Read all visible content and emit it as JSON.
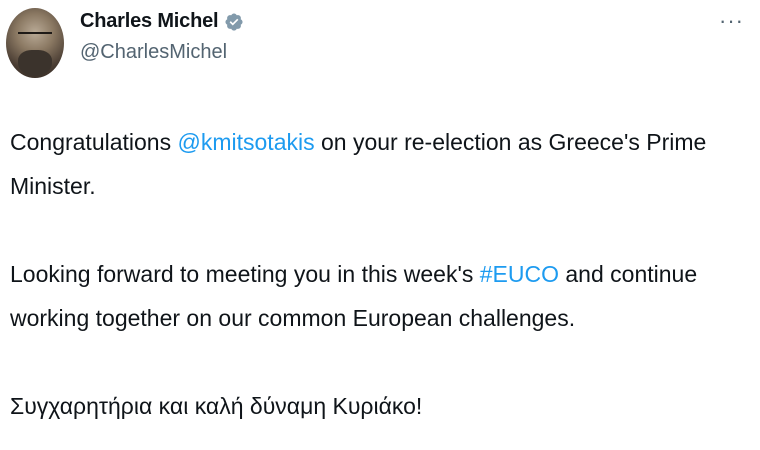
{
  "author": {
    "display_name": "Charles Michel",
    "handle": "@CharlesMichel",
    "verified_icon": "verified-badge-icon"
  },
  "menu": {
    "more_label": "···"
  },
  "tweet": {
    "p1": {
      "before": "Congratulations ",
      "mention": "@kmitsotakis",
      "after": " on your re-election as Greece's Prime Minister."
    },
    "p2": {
      "before": "Looking forward to meeting you in this week's ",
      "hashtag": "#EUCO",
      "after": " and continue working together on our common European challenges."
    },
    "p3": "Συγχαρητήρια και καλή δύναμη Κυριάκο!"
  },
  "colors": {
    "link": "#1d9bf0",
    "verified": "#829aab",
    "secondary_text": "#536471"
  }
}
